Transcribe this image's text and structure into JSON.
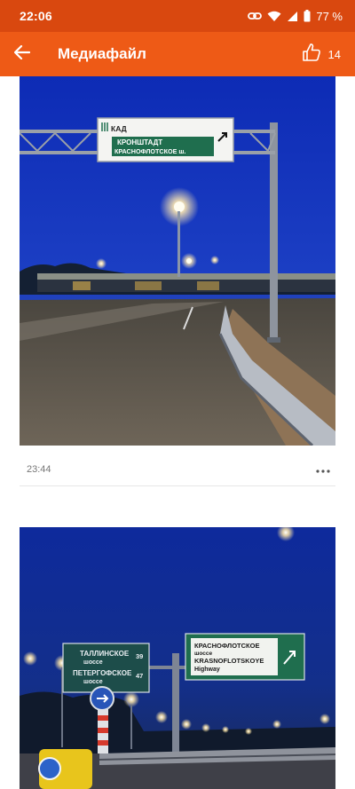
{
  "status_bar": {
    "time": "22:06",
    "battery": "77 %",
    "icons": [
      "link-icon",
      "wifi-icon",
      "signal-icon",
      "battery-icon"
    ]
  },
  "app_bar": {
    "title": "Медиафайл",
    "like_count": "14",
    "icons": [
      "back-arrow-icon",
      "thumbs-up-icon"
    ]
  },
  "colors": {
    "status_bar": "#d9480f",
    "app_bar": "#ee5a16",
    "sign_green": "#1f6e4e"
  },
  "posts": [
    {
      "time": "23:44",
      "sign": {
        "line1": "КАД",
        "line2": "КРОНШТАДТ",
        "line3": "КРАСНОФЛОТСКОЕ ш."
      }
    },
    {
      "sign_left": {
        "line1": "ТАЛЛИНСКОЕ",
        "line2": "шоссе",
        "num1": "39",
        "line3": "ПЕТЕРГОФСКОЕ",
        "line4": "шоссе",
        "num2": "47"
      },
      "sign_right": {
        "line1": "КРАСНОФЛОТСКОЕ",
        "line2": "шоссе",
        "line3": "KRASNOFLOTSKOYE",
        "line4": "Highway"
      }
    }
  ]
}
